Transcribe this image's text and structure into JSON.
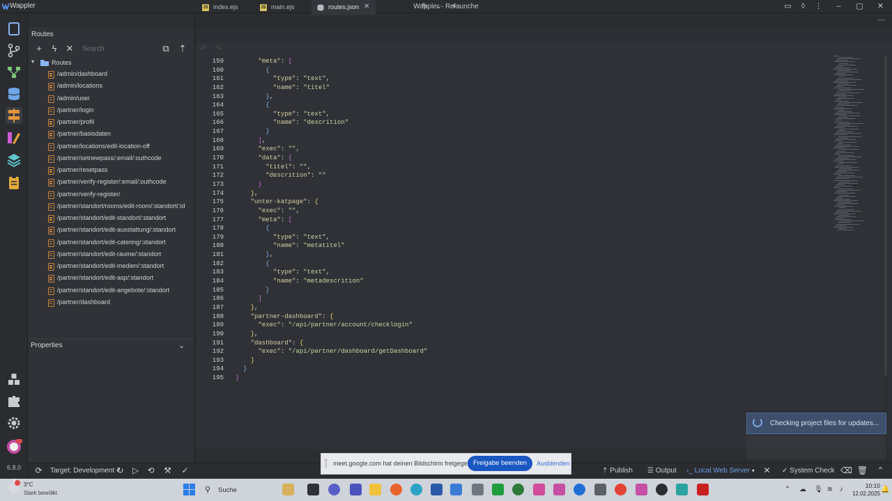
{
  "app": {
    "name": "Wappler",
    "window_title": "Wappler - Relaunche",
    "version": "6.8.0"
  },
  "sidebar": {
    "routes_title": "Routes",
    "search_placeholder": "Search",
    "root_label": "Routes",
    "routes": [
      "/admin/dashboard",
      "/admin/locations",
      "/admin/user",
      "/partner/login",
      "/partner/profil",
      "/partner/basisdaten",
      "/partner/locations/edit-location-off",
      "/partner/setnewpass/:email/:outhcode",
      "/partner/resetpass",
      "/partner/verify-register/:email/:outhcode",
      "/partner/verify-register/",
      "/partner/standort/rooms/edit-room/:standort/:id",
      "/partner/standort/edit-standort/:standort",
      "/partner/standort/edit-ausstattung/:standort",
      "/partner/standort/edit-catering/:standort",
      "/partner/standort/edit-raume/:standort",
      "/partner/standort/edit-medien/:standort",
      "/partner/standort/edit-asp/:standort",
      "/partner/standort/edit-angebote/:standort",
      "/partner/dashboard"
    ],
    "properties_title": "Properties"
  },
  "tabs": [
    {
      "label": "index.ejs",
      "type": "JS",
      "active": false
    },
    {
      "label": "main.ejs",
      "type": "JS",
      "active": false
    },
    {
      "label": "routes.json",
      "type": "json",
      "active": true
    }
  ],
  "editor": {
    "line_start": 159,
    "lines": [
      "      \"meta\": [",
      "        {",
      "          \"type\": \"text\",",
      "          \"name\": \"titel\"",
      "        },",
      "        {",
      "          \"type\": \"text\",",
      "          \"name\": \"descrition\"",
      "        }",
      "      ],",
      "      \"exec\": \"\",",
      "      \"data\": {",
      "        \"titel\": \"\",",
      "        \"descrition\": \"\"",
      "      }",
      "    },",
      "    \"unter-katpage\": {",
      "      \"exec\": \"\",",
      "      \"meta\": [",
      "        {",
      "          \"type\": \"text\",",
      "          \"name\": \"metatitel\"",
      "        },",
      "        {",
      "          \"type\": \"text\",",
      "          \"name\": \"metadescrition\"",
      "        }",
      "      ]",
      "    },",
      "    \"partner-dashboard\": {",
      "      \"exec\": \"/api/partner/account/checklogin\"",
      "    },",
      "    \"dashboard\": {",
      "      \"exec\": \"/api/partner/dashboard/getDashboard\"",
      "    }",
      "  }",
      "}"
    ]
  },
  "notification": {
    "text": "Checking project files for updates..."
  },
  "share_bar": {
    "text": "meet.google.com hat deinen Bildschirm freigegeben.",
    "stop_label": "Freigabe beenden",
    "hide_label": "Ausblenden"
  },
  "statusbar": {
    "target": "Target: Development",
    "publish": "Publish",
    "output": "Output",
    "server": "Local Web Server",
    "system_check": "System Check"
  },
  "taskbar": {
    "weather_temp": "3°C",
    "weather_desc": "Stark bewölkt",
    "search_label": "Suche",
    "time": "10:10",
    "date": "12.02.2025",
    "badge_count": "3"
  },
  "colors": {
    "accent": "#1a57c2",
    "route_icon": "#c7843a",
    "notify_bg": "#3d4f6b"
  }
}
